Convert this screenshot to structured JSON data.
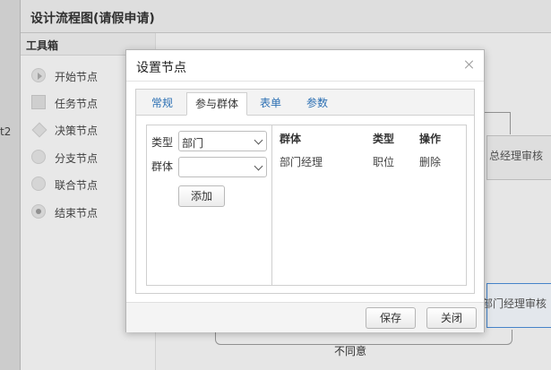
{
  "app": {
    "title": "设计流程图(请假申请)",
    "left_cut_text": "t2",
    "toolbox": {
      "header": "工具箱",
      "items": [
        {
          "label": "开始节点",
          "icon": "start-node-icon"
        },
        {
          "label": "任务节点",
          "icon": "task-node-icon"
        },
        {
          "label": "决策节点",
          "icon": "decision-node-icon"
        },
        {
          "label": "分支节点",
          "icon": "fork-node-icon"
        },
        {
          "label": "联合节点",
          "icon": "join-node-icon"
        },
        {
          "label": "结束节点",
          "icon": "end-node-icon"
        }
      ]
    },
    "canvas": {
      "node_general_manager": "总经理审核",
      "node_dept_manager": "部门经理审核",
      "edge_label": "不同意"
    }
  },
  "dialog": {
    "title": "设置节点",
    "tabs": [
      {
        "label": "常规",
        "active": false
      },
      {
        "label": "参与群体",
        "active": true
      },
      {
        "label": "表单",
        "active": false
      },
      {
        "label": "参数",
        "active": false
      }
    ],
    "form": {
      "type_label": "类型",
      "type_value": "部门",
      "group_label": "群体",
      "group_value": "",
      "add_label": "添加"
    },
    "table": {
      "headers": [
        "群体",
        "类型",
        "操作"
      ],
      "rows": [
        {
          "group": "部门经理",
          "type": "职位",
          "action": "删除"
        }
      ]
    },
    "footer": {
      "save_label": "保存",
      "close_label": "关闭"
    }
  },
  "colors": {
    "tab_link": "#2b6fb3",
    "node_highlight_border": "#4a8cd6"
  }
}
